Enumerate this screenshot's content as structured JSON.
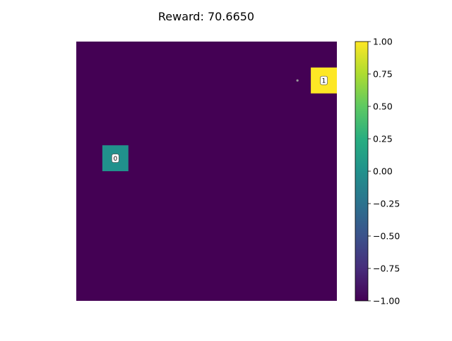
{
  "title": "Reward: 70.6650",
  "grid": {
    "rows": 10,
    "cols": 10,
    "background_value": -1.0,
    "cells": [
      {
        "row": 1,
        "col": 9,
        "value": 1.0,
        "label": "1"
      },
      {
        "row": 4,
        "col": 1,
        "value": 0.0,
        "label": "0"
      }
    ],
    "marker": {
      "row": 1,
      "col": 8.5
    }
  },
  "colorbar": {
    "min": -1.0,
    "max": 1.0,
    "ticks": [
      {
        "value": 1.0,
        "label": "1.00"
      },
      {
        "value": 0.75,
        "label": "0.75"
      },
      {
        "value": 0.5,
        "label": "0.50"
      },
      {
        "value": 0.25,
        "label": "0.25"
      },
      {
        "value": 0.0,
        "label": "0.00"
      },
      {
        "value": -0.25,
        "label": "−0.25"
      },
      {
        "value": -0.5,
        "label": "−0.50"
      },
      {
        "value": -0.75,
        "label": "−0.75"
      },
      {
        "value": -1.0,
        "label": "−1.00"
      }
    ],
    "colormap": "viridis"
  },
  "colors": {
    "low": "#440154",
    "mid": "#21918c",
    "high": "#fde725"
  }
}
